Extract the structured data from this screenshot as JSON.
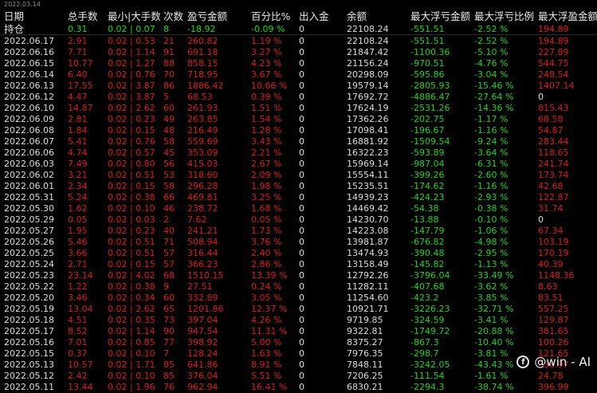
{
  "top_date": "2022.03.14",
  "headers": [
    "日期",
    "总手数",
    "最小|大手数",
    "次数",
    "盈亏金额",
    "百分比%",
    "出入金",
    "余额",
    "最大浮亏金额",
    "最大浮亏比例",
    "最大浮盈金额"
  ],
  "holding": {
    "label": "持仓",
    "lots": "0.31",
    "minmax": "0.02 | 0.07",
    "count": "8",
    "pnl": "-18.92",
    "pct": "-0.09 %",
    "io": "0",
    "balance": "22108.24",
    "max_float_loss": "-551.51",
    "max_float_loss_pct": "-2.52 %",
    "max_float_profit": "194.89"
  },
  "rows": [
    [
      "2022.06.17",
      "2.91",
      "0.02 | 0.53",
      "21",
      "260.82",
      "1.19 %",
      "0",
      "22108.24",
      "-551.51",
      "-2.52 %",
      "194.89"
    ],
    [
      "2022.06.16",
      "7.71",
      "0.02 | 1.14",
      "91",
      "691.18",
      "3.27 %",
      "0",
      "21847.42",
      "-1100.36",
      "-5.10 %",
      "227.89"
    ],
    [
      "2022.06.15",
      "10.77",
      "0.02 | 1.27",
      "88",
      "858.15",
      "4.23 %",
      "0",
      "21156.24",
      "-970.51",
      "-4.76 %",
      "544.75"
    ],
    [
      "2022.06.14",
      "6.40",
      "0.02 | 0.76",
      "70",
      "718.95",
      "3.67 %",
      "0",
      "20298.09",
      "-595.86",
      "-3.04 %",
      "248.54"
    ],
    [
      "2022.06.13",
      "17.55",
      "0.02 | 3.87",
      "86",
      "1886.42",
      "10.66 %",
      "0",
      "19579.14",
      "-2805.93",
      "-15.46 %",
      "1407.14"
    ],
    [
      "2022.06.12",
      "4.47",
      "0.02 | 3.87",
      "5",
      "68.53",
      "0.39 %",
      "0",
      "17692.72",
      "-4886.47",
      "-27.64 %",
      "0"
    ],
    [
      "2022.06.10",
      "14.87",
      "0.02 | 2.62",
      "60",
      "261.93",
      "1.51 %",
      "0",
      "17624.19",
      "-2531.26",
      "-14.36 %",
      "815.43"
    ],
    [
      "2022.06.09",
      "2.81",
      "0.02 | 0.23",
      "49",
      "263.85",
      "1.54 %",
      "0",
      "17362.26",
      "-202.75",
      "-1.17 %",
      "68.58"
    ],
    [
      "2022.06.08",
      "1.84",
      "0.02 | 0.15",
      "48",
      "216.49",
      "1.28 %",
      "0",
      "17098.41",
      "-196.67",
      "-1.16 %",
      "54.87"
    ],
    [
      "2022.06.07",
      "5.41",
      "0.02 | 0.76",
      "58",
      "559.69",
      "3.43 %",
      "0",
      "16881.92",
      "-1509.54",
      "-9.24 %",
      "283.44"
    ],
    [
      "2022.06.06",
      "4.74",
      "0.02 | 0.57",
      "45",
      "353.09",
      "2.21 %",
      "0",
      "16322.23",
      "-593.89",
      "-3.64 %",
      "118.65"
    ],
    [
      "2022.06.03",
      "7.49",
      "0.02 | 0.80",
      "56",
      "415.03",
      "2.67 %",
      "0",
      "15969.14",
      "-987.04",
      "-6.31 %",
      "241.74"
    ],
    [
      "2022.06.02",
      "3.21",
      "0.02 | 0.51",
      "53",
      "318.60",
      "2.09 %",
      "0",
      "15554.11",
      "-399.26",
      "-2.60 %",
      "173.74"
    ],
    [
      "2022.06.01",
      "2.34",
      "0.02 | 0.15",
      "58",
      "296.28",
      "1.98 %",
      "0",
      "15235.51",
      "-174.62",
      "-1.16 %",
      "42.68"
    ],
    [
      "2022.05.31",
      "5.24",
      "0.02 | 0.38",
      "66",
      "469.81",
      "3.25 %",
      "0",
      "14939.23",
      "-424.23",
      "-2.93 %",
      "122.87"
    ],
    [
      "2022.05.30",
      "1.62",
      "0.02 | 0.10",
      "46",
      "238.72",
      "1.68 %",
      "0",
      "14469.42",
      "-54.38",
      "-0.38 %",
      "31.74"
    ],
    [
      "2022.05.29",
      "0.05",
      "0.02 | 0.03",
      "2",
      "7.62",
      "0.05 %",
      "0",
      "14230.70",
      "-13.88",
      "-0.10 %",
      "0"
    ],
    [
      "2022.05.27",
      "1.95",
      "0.02 | 0.23",
      "40",
      "241.21",
      "1.73 %",
      "0",
      "14223.08",
      "-147.79",
      "-1.06 %",
      "67.34"
    ],
    [
      "2022.05.26",
      "5.46",
      "0.02 | 0.51",
      "71",
      "508.94",
      "3.76 %",
      "0",
      "13981.87",
      "-676.82",
      "-4.98 %",
      "103.19"
    ],
    [
      "2022.05.25",
      "3.66",
      "0.02 | 0.51",
      "57",
      "316.44",
      "2.40 %",
      "0",
      "13474.93",
      "-390.48",
      "-2.95 %",
      "170.19"
    ],
    [
      "2022.05.24",
      "2.71",
      "0.02 | 0.15",
      "57",
      "366.23",
      "2.86 %",
      "0",
      "13158.49",
      "-145.82",
      "-1.13 %",
      "40.39"
    ],
    [
      "2022.05.23",
      "23.14",
      "0.02 | 4.02",
      "68",
      "1510.15",
      "13.39 %",
      "0",
      "12792.26",
      "-3796.04",
      "-33.49 %",
      "1148.36"
    ],
    [
      "2022.05.22",
      "1.22",
      "0.02 | 0.38",
      "9",
      "27.51",
      "0.24 %",
      "0",
      "11282.11",
      "-407.68",
      "-3.62 %",
      "8.63"
    ],
    [
      "2022.05.20",
      "3.46",
      "0.02 | 0.34",
      "60",
      "332.89",
      "3.05 %",
      "0",
      "11254.60",
      "-423.2",
      "-3.85 %",
      "83.51"
    ],
    [
      "2022.05.19",
      "13.04",
      "0.02 | 2.62",
      "65",
      "1201.86",
      "12.37 %",
      "0",
      "10921.71",
      "-3226.23",
      "-32.71 %",
      "557.25"
    ],
    [
      "2022.05.18",
      "4.51",
      "0.02 | 0.35",
      "73",
      "397.04",
      "4.26 %",
      "0",
      "9719.85",
      "-324.59",
      "-3.41 %",
      "129.87"
    ],
    [
      "2022.05.17",
      "8.52",
      "0.02 | 1.14",
      "90",
      "947.54",
      "11.31 %",
      "0",
      "9322.81",
      "-1749.72",
      "-20.88 %",
      "381.65"
    ],
    [
      "2022.05.16",
      "7.01",
      "0.02 | 0.85",
      "77",
      "398.92",
      "5.00 %",
      "0",
      "8375.27",
      "-867.3",
      "-10.40 %",
      "100.26"
    ],
    [
      "2022.05.15",
      "0.37",
      "0.02 | 0.10",
      "7",
      "128.24",
      "1.63 %",
      "0",
      "7976.35",
      "-298.7",
      "-3.81 %",
      "121.65"
    ],
    [
      "2022.05.13",
      "10.57",
      "0.02 | 1.71",
      "85",
      "641.86",
      "8.91 %",
      "0",
      "7848.11",
      "-3242.05",
      "-43.43 %",
      "338.97"
    ],
    [
      "2022.05.12",
      "2.42",
      "0.02 | 0.10",
      "85",
      "376.04",
      "5.51 %",
      "0",
      "7206.25",
      "-111.54",
      "-1.61 %",
      "24.78"
    ],
    [
      "2022.05.11",
      "13.44",
      "0.02 | 1.96",
      "76",
      "962.94",
      "16.41 %",
      "0",
      "6830.21",
      "-2294.3",
      "-38.74 %",
      "396.99"
    ]
  ],
  "watermark": "@win - AI",
  "colors": {
    "background": "#000000",
    "profit": "#e01818",
    "loss": "#18d818",
    "neutral": "#dcdcdc"
  }
}
